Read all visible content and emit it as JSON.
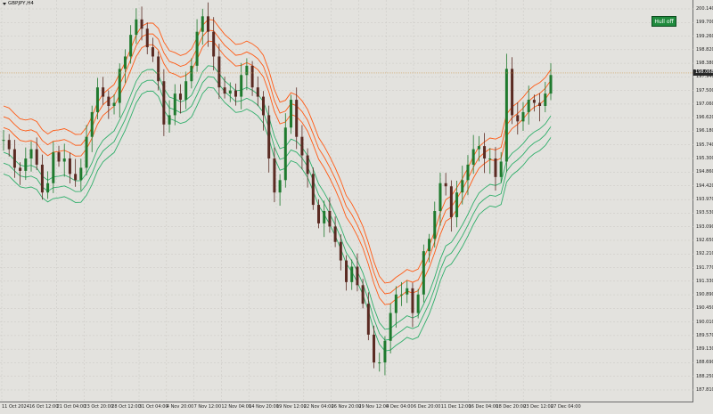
{
  "window": {
    "symbol": "GBPJPY,H4"
  },
  "status_badge": "Hull off",
  "current_price": "198.068",
  "colors": {
    "background": "#e3e2de",
    "grid": "#c9c7c2",
    "candle_bull": "#1f7a2e",
    "candle_bear": "#5a2a22",
    "band_upper": "#ff5a14",
    "band_lower": "#2fae6a",
    "badge": "#1f8a3d",
    "price_line": "#d2a060"
  },
  "price_axis": {
    "labels": [
      "200.140",
      "199.700",
      "199.260",
      "198.820",
      "198.380",
      "197.940",
      "197.500",
      "197.060",
      "196.620",
      "196.180",
      "195.740",
      "195.300",
      "194.860",
      "194.420",
      "193.970",
      "193.530",
      "193.090",
      "192.650",
      "192.210",
      "191.770",
      "191.330",
      "190.890",
      "190.450",
      "190.010",
      "189.570",
      "189.130",
      "188.690",
      "188.250",
      "187.810"
    ]
  },
  "time_axis": {
    "labels": [
      "11 Oct 2024",
      "16 Oct 12:00",
      "21 Oct 04:00",
      "23 Oct 20:00",
      "28 Oct 12:00",
      "31 Oct 04:00",
      "4 Nov 20:00",
      "7 Nov 12:00",
      "12 Nov 04:00",
      "14 Nov 20:00",
      "19 Nov 12:00",
      "22 Nov 04:00",
      "26 Nov 20:00",
      "29 Nov 12:00",
      "4 Dec 04:00",
      "6 Dec 20:00",
      "11 Dec 12:00",
      "16 Dec 04:00",
      "18 Dec 20:00",
      "23 Dec 12:00",
      "27 Dec 04:00"
    ]
  },
  "chart_data": {
    "type": "candlestick",
    "series": [
      {
        "name": "GBPJPY H4",
        "values": [
          195.9,
          195.6,
          195.0,
          194.9,
          195.3,
          195.6,
          195.1,
          194.2,
          194.5,
          195.5,
          195.2,
          195.3,
          194.8,
          194.6,
          195.0,
          196.0,
          196.8,
          197.6,
          197.3,
          197.0,
          197.1,
          198.2,
          198.6,
          199.3,
          199.8,
          199.5,
          198.9,
          198.6,
          197.8,
          196.4,
          196.7,
          197.4,
          197.2,
          197.8,
          198.3,
          199.4,
          199.9,
          199.4,
          198.6,
          197.6,
          197.4,
          197.5,
          197.3,
          198.0,
          198.3,
          197.6,
          197.3,
          196.7,
          195.3,
          194.2,
          194.6,
          196.3,
          197.2,
          196.0,
          195.4,
          194.8,
          193.8,
          193.2,
          193.6,
          193.1,
          192.6,
          192.0,
          191.3,
          191.8,
          191.2,
          190.6,
          189.6,
          188.7,
          188.7,
          189.4,
          190.3,
          190.9,
          190.9,
          191.1,
          190.3,
          190.9,
          192.3,
          192.7,
          193.6,
          194.5,
          194.4,
          193.4,
          194.2,
          194.6,
          195.1,
          195.6,
          195.7,
          195.3,
          195.3,
          194.7,
          195.2,
          198.2,
          196.7,
          196.5,
          196.8,
          197.2,
          197.1,
          197.0,
          197.4,
          198.0
        ]
      }
    ],
    "ylim": [
      187.81,
      200.14
    ],
    "bands": [
      {
        "name": "upper",
        "color": "#ff5a14"
      },
      {
        "name": "lower",
        "color": "#2fae6a"
      }
    ]
  }
}
